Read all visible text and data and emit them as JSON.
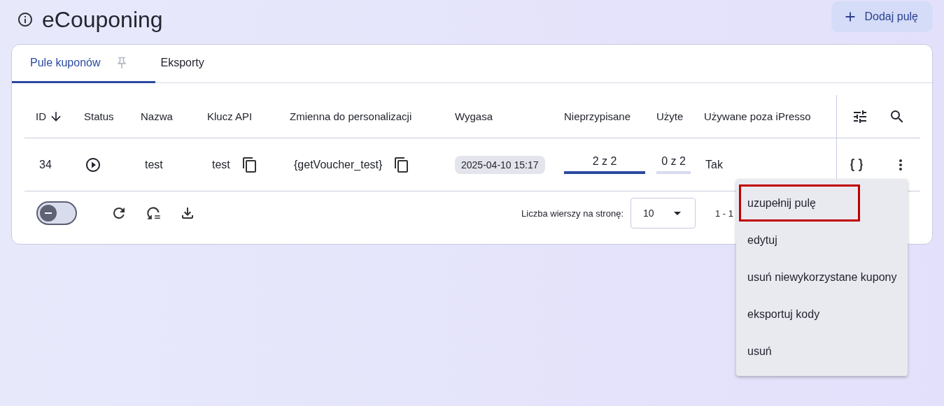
{
  "header": {
    "title": "eCouponing",
    "add_button": "Dodaj pulę"
  },
  "tabs": [
    {
      "label": "Pule kuponów",
      "selected": true,
      "pinned": true
    },
    {
      "label": "Eksporty",
      "selected": false,
      "pinned": false
    }
  ],
  "table": {
    "columns": [
      {
        "label": "ID",
        "sorted": true
      },
      {
        "label": "Status",
        "sorted": false
      },
      {
        "label": "Nazwa",
        "sorted": false
      },
      {
        "label": "Klucz API",
        "sorted": false
      },
      {
        "label": "Zmienna do personalizacji",
        "sorted": false
      },
      {
        "label": "Wygasa",
        "sorted": false
      },
      {
        "label": "Nieprzypisane",
        "sorted": false
      },
      {
        "label": "Użyte",
        "sorted": false
      },
      {
        "label": "Używane poza iPresso",
        "sorted": false
      }
    ],
    "rows": [
      {
        "id": "34",
        "name": "test",
        "api_key": "test",
        "variable": "{getVoucher_test}",
        "expires": "2025-04-10 15:17",
        "unassigned": {
          "text": "2 z 2",
          "level": 1
        },
        "used": {
          "text": "0 z 2",
          "level": 0
        },
        "external": "Tak"
      }
    ]
  },
  "footer": {
    "toggle": {
      "on": false
    },
    "rows_per_page_label": "Liczba wierszy na stronę:",
    "rows_per_page": "10",
    "range": "1 - 1"
  },
  "menu": {
    "items": [
      {
        "label": "uzupełnij pulę",
        "highlighted": true
      },
      {
        "label": "edytuj",
        "highlighted": false
      },
      {
        "label": "usuń niewykorzystane kupony",
        "highlighted": false
      },
      {
        "label": "eksportuj kody",
        "highlighted": false
      },
      {
        "label": "usuń",
        "highlighted": false
      }
    ]
  }
}
